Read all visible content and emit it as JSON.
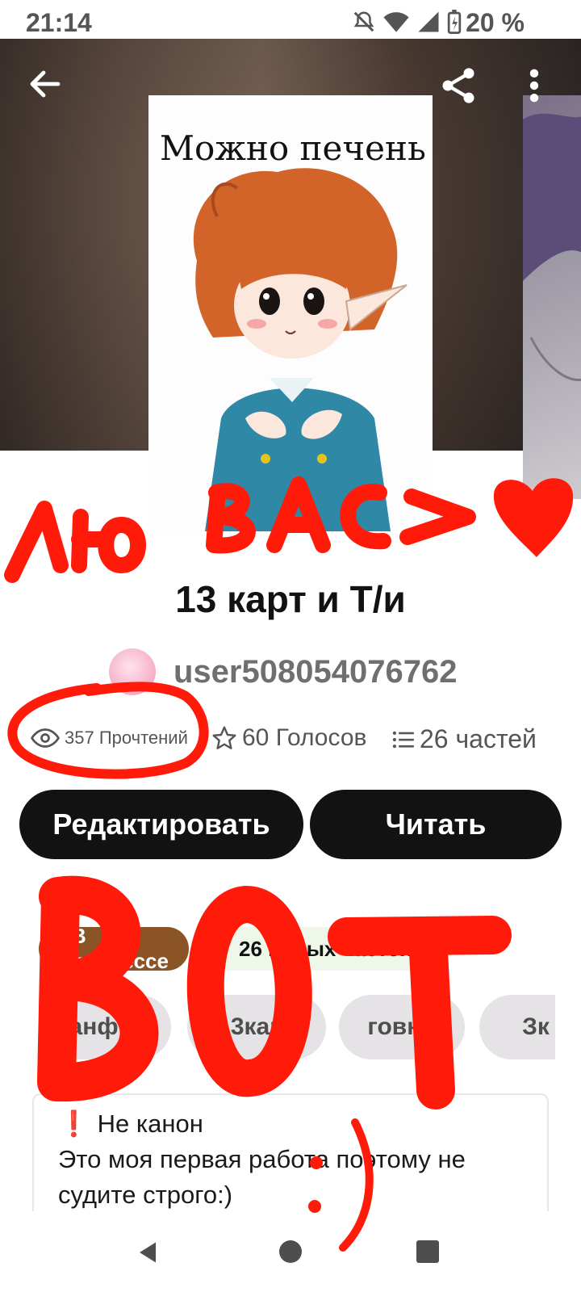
{
  "status_bar": {
    "time": "21:14",
    "battery": "20 %",
    "icons": [
      "mute-icon",
      "wifi-icon",
      "signal-icon",
      "battery-charging-icon"
    ]
  },
  "header": {
    "back_icon": "arrow-left-icon",
    "share_icon": "share-icon",
    "more_icon": "more-vertical-icon",
    "cover_text": "Можно печень"
  },
  "story": {
    "title": "13 карт и Т/и",
    "author": "user508054076762"
  },
  "stats": {
    "reads": "357 Прочтений",
    "votes": "60 Голосов",
    "parts": "26 частей"
  },
  "actions": {
    "edit_label": "Редактировать",
    "read_label": "Читать"
  },
  "status_chips": {
    "progress": "В процессе",
    "parts": "26 новых частей"
  },
  "tags": [
    "Фанфик",
    "13карт",
    "говно",
    "Зк"
  ],
  "description": {
    "line1": "Не канон",
    "line2": "Это моя первая работа поэтому не",
    "line3": "судите строго:)"
  },
  "annotations": {
    "top_scribble": "лю вас >",
    "bottom_scribble": "ВОТ",
    "face": ":)"
  },
  "colors": {
    "primary_button": "#121212",
    "progress_chip": "#8a5426",
    "doodle_red": "#ff1a0a"
  }
}
